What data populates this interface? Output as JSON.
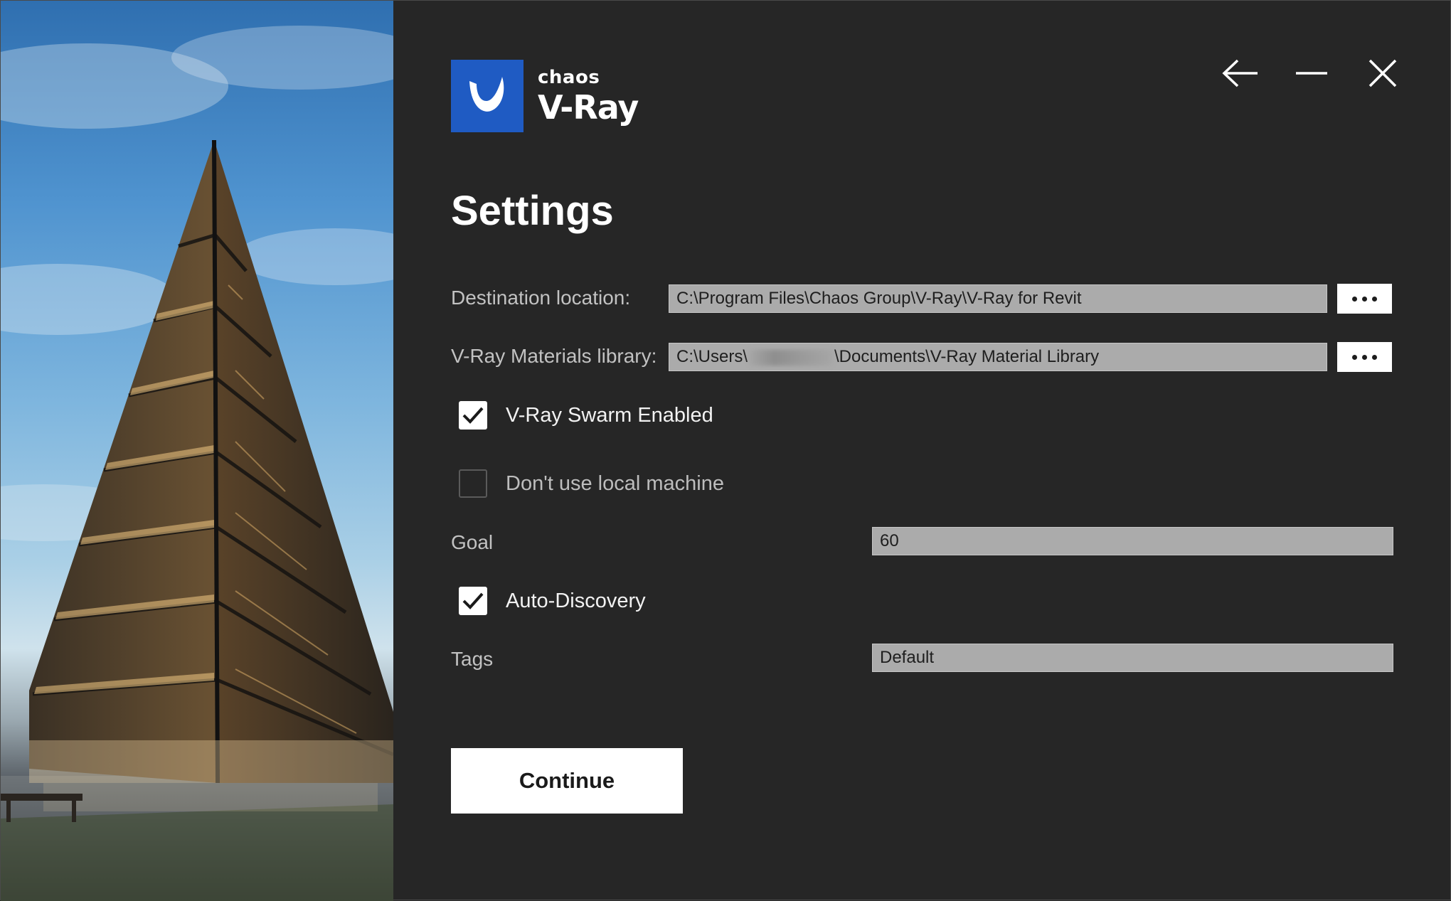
{
  "window": {
    "brand_small": "chaos",
    "brand_large": "V-Ray",
    "accent_color": "#1f5bc3",
    "controls": {
      "back_icon": "arrow-left-icon",
      "minimize_icon": "minimize-icon",
      "close_icon": "close-icon"
    }
  },
  "page": {
    "title": "Settings"
  },
  "settings": {
    "destination": {
      "label": "Destination location:",
      "value": "C:\\Program Files\\Chaos Group\\V-Ray\\V-Ray for Revit"
    },
    "materials": {
      "label": "V-Ray Materials library:",
      "value_prefix": "C:\\Users\\",
      "value_suffix": "\\Documents\\V-Ray Material Library"
    },
    "swarm": {
      "label": "V-Ray Swarm Enabled",
      "checked": true
    },
    "local_machine": {
      "label": "Don't use local machine",
      "checked": false
    },
    "goal": {
      "label": "Goal",
      "value": "60"
    },
    "auto_discovery": {
      "label": "Auto-Discovery",
      "checked": true
    },
    "tags": {
      "label": "Tags",
      "value": "Default"
    }
  },
  "actions": {
    "continue_label": "Continue"
  }
}
